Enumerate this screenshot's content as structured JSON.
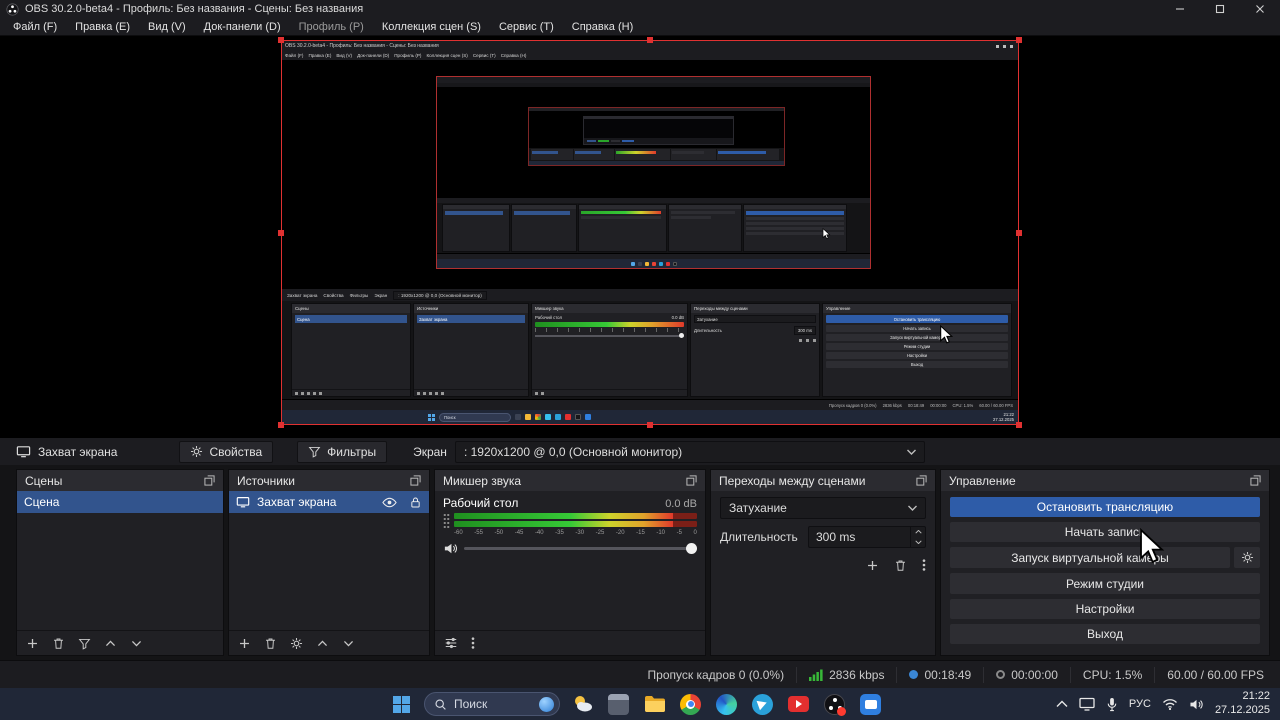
{
  "window": {
    "title": "OBS 30.2.0-beta4 - Профиль: Без названия - Сцены: Без названия"
  },
  "menu": {
    "items": [
      "Файл (F)",
      "Правка (E)",
      "Вид (V)",
      "Док-панели (D)",
      "Профиль (P)",
      "Коллекция сцен (S)",
      "Сервис (T)",
      "Справка (H)"
    ]
  },
  "source_toolbar": {
    "source_name": "Захват экрана",
    "properties": "Свойства",
    "filters": "Фильтры",
    "screen_label": "Экран",
    "screen_value": ": 1920x1200 @ 0,0 (Основной монитор)"
  },
  "docks": {
    "scenes": {
      "title": "Сцены",
      "items": [
        "Сцена"
      ]
    },
    "sources": {
      "title": "Источники",
      "items": [
        "Захват экрана"
      ]
    },
    "mixer": {
      "title": "Микшер звука",
      "channel": "Рабочий стол",
      "level_db": "0.0 dB",
      "scale": [
        "-60",
        "-55",
        "-50",
        "-45",
        "-40",
        "-35",
        "-30",
        "-25",
        "-20",
        "-15",
        "-10",
        "-5",
        "0"
      ]
    },
    "transitions": {
      "title": "Переходы между сценами",
      "transition": "Затухание",
      "duration_label": "Длительность",
      "duration_value": "300 ms"
    },
    "controls": {
      "title": "Управление",
      "stop_stream": "Остановить трансляцию",
      "start_record": "Начать запись",
      "virtual_camera": "Запуск виртуальной камеры",
      "studio_mode": "Режим студии",
      "settings": "Настройки",
      "exit": "Выход"
    }
  },
  "statusbar": {
    "dropped_frames": "Пропуск кадров 0 (0.0%)",
    "bitrate": "2836 kbps",
    "stream_time": "00:18:49",
    "record_time": "00:00:00",
    "cpu": "CPU: 1.5%",
    "fps": "60.00 / 60.00 FPS"
  },
  "taskbar": {
    "search_placeholder": "Поиск",
    "language": "РУС",
    "time": "21:22",
    "date": "27.12.2025"
  },
  "icons": {
    "window_minimize": "minus-line",
    "window_maximize": "square-outline",
    "window_close": "x-lines",
    "dock_popout": "two-overlapping-squares",
    "add": "plus",
    "remove": "trash-can",
    "scene_filters": "funnel",
    "move_up": "chevron-up",
    "move_down": "chevron-down",
    "source_visible": "eye",
    "source_lock": "padlock",
    "properties": "gear",
    "mixer_settings": "sliders",
    "menu_dots": "vertical-dots",
    "speaker": "speaker-waves",
    "bitrate_signal": "green-bars",
    "search": "magnifier",
    "tray_expand": "chevron-up",
    "tray_display": "monitor",
    "tray_mic": "microphone",
    "tray_network": "wifi",
    "tray_volume": "speaker"
  },
  "colors": {
    "accent_button": "#2e5ca8",
    "selection": "#32548d",
    "source_outline": "#e03131",
    "meter_green": "#36c936",
    "record_badge": "#ff3b30"
  }
}
